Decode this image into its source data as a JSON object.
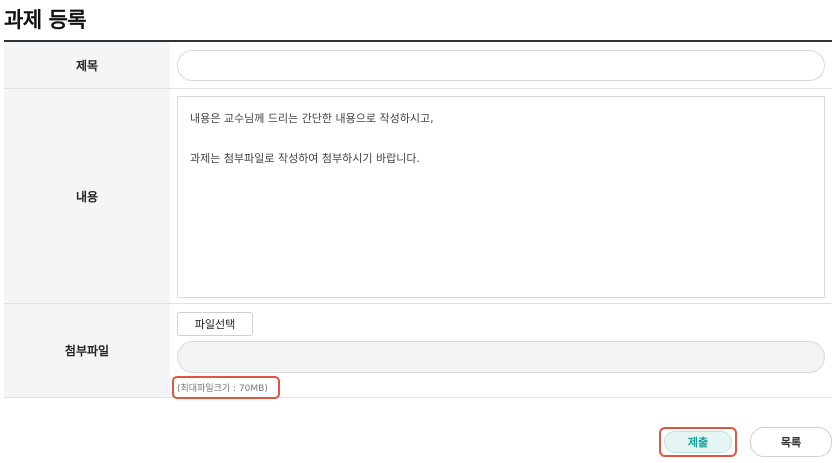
{
  "page": {
    "title": "과제 등록"
  },
  "form": {
    "title_label": "제목",
    "title_value": "",
    "content_label": "내용",
    "content_lines": [
      "내용은 교수님께 드리는 간단한 내용으로 작성하시고,",
      "과제는 첨부파일로 작성하여 첨부하시기 바랍니다."
    ],
    "attach_label": "첨부파일",
    "file_button": "파일선택",
    "max_size_note": "(최대파일크기 : 70MB)"
  },
  "actions": {
    "submit": "제출",
    "list": "목록"
  },
  "colors": {
    "highlight": "#e0553f",
    "submit_text": "#17a29a",
    "submit_bg": "#e4f5f4"
  }
}
